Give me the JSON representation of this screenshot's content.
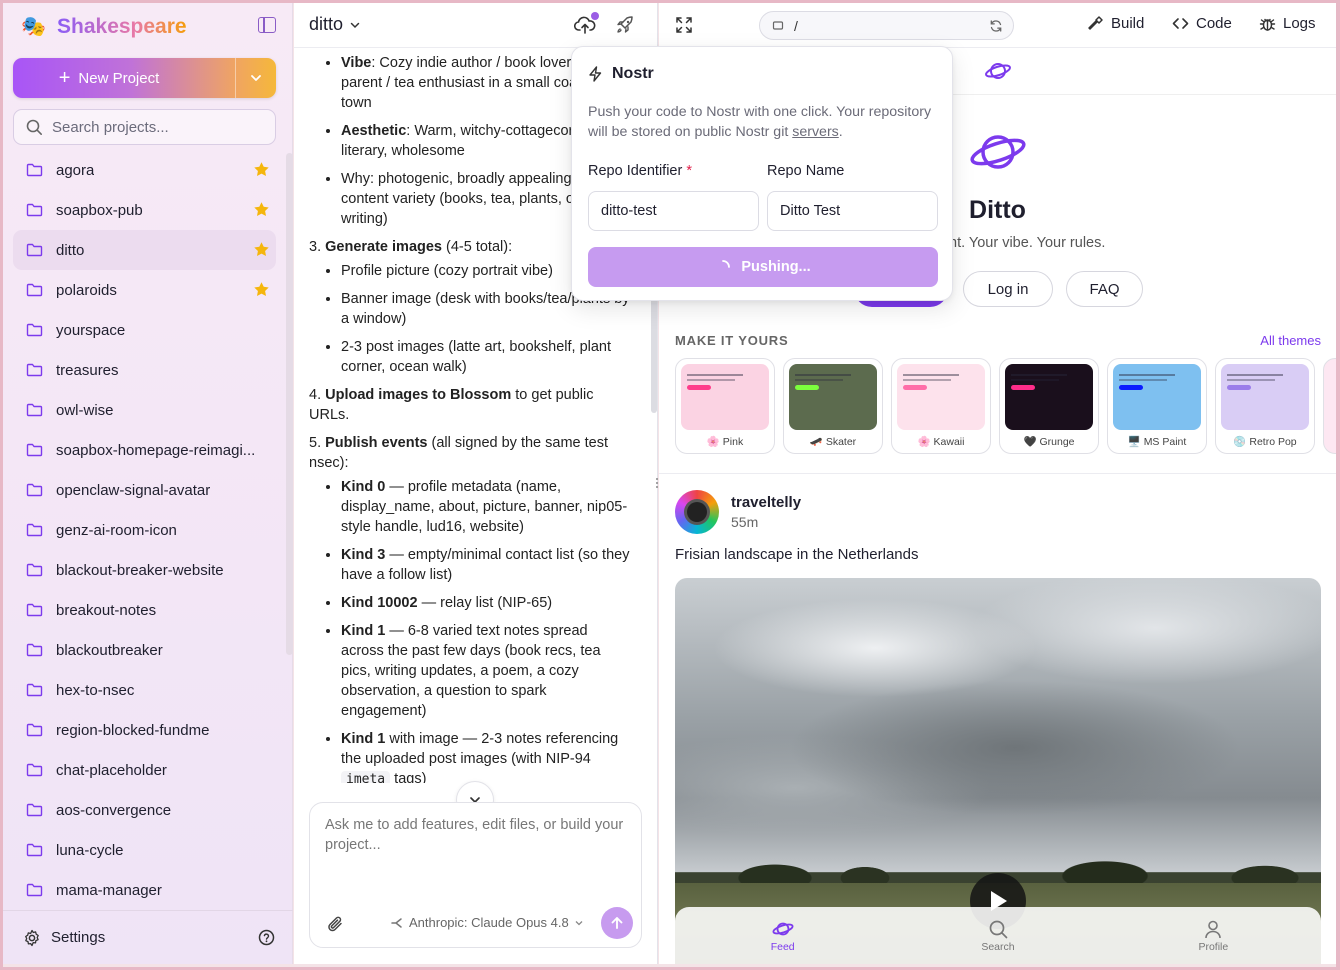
{
  "sidebar": {
    "brand": "Shakespeare",
    "new_project": "New Project",
    "search_placeholder": "Search projects...",
    "projects": [
      {
        "name": "agora",
        "starred": true
      },
      {
        "name": "soapbox-pub",
        "starred": true
      },
      {
        "name": "ditto",
        "starred": true,
        "active": true
      },
      {
        "name": "polaroids",
        "starred": true
      },
      {
        "name": "yourspace",
        "starred": false
      },
      {
        "name": "treasures",
        "starred": false
      },
      {
        "name": "owl-wise",
        "starred": false
      },
      {
        "name": "soapbox-homepage-reimagi...",
        "starred": false
      },
      {
        "name": "openclaw-signal-avatar",
        "starred": false
      },
      {
        "name": "genz-ai-room-icon",
        "starred": false
      },
      {
        "name": "blackout-breaker-website",
        "starred": false
      },
      {
        "name": "breakout-notes",
        "starred": false
      },
      {
        "name": "blackoutbreaker",
        "starred": false
      },
      {
        "name": "hex-to-nsec",
        "starred": false
      },
      {
        "name": "region-blocked-fundme",
        "starred": false
      },
      {
        "name": "chat-placeholder",
        "starred": false
      },
      {
        "name": "aos-convergence",
        "starred": false
      },
      {
        "name": "luna-cycle",
        "starred": false
      },
      {
        "name": "mama-manager",
        "starred": false
      }
    ],
    "settings": "Settings"
  },
  "chat": {
    "project_title": "ditto",
    "persona": [
      {
        "bold": "Vibe",
        "text": ": Cozy indie author / book lover / plant parent / tea enthusiast in a small coastal town"
      },
      {
        "bold": "Aesthetic",
        "text": ": Warm, witchy-cottagecore, literary, wholesome"
      },
      {
        "bold": "",
        "text": "Why: photogenic, broadly appealing, natural content variety (books, tea, plants, ocean, writing)"
      }
    ],
    "step3": {
      "num": "3.",
      "bold": "Generate images",
      "text": " (4-5 total):"
    },
    "step3_items": [
      "Profile picture (cozy portrait vibe)",
      "Banner image (desk with books/tea/plants by a window)",
      "2-3 post images (latte art, bookshelf, plant corner, ocean walk)"
    ],
    "step4": {
      "num": "4.",
      "bold": "Upload images to Blossom",
      "text": " to get public URLs."
    },
    "step5": {
      "num": "5.",
      "bold": "Publish events",
      "text": " (all signed by the same test nsec):"
    },
    "step5_items": [
      {
        "bold": "Kind 0",
        "text": " — profile metadata (name, display_name, about, picture, banner, nip05-style handle, lud16, website)"
      },
      {
        "bold": "Kind 3",
        "text": " — empty/minimal contact list (so they have a follow list)"
      },
      {
        "bold": "Kind 10002",
        "text": " — relay list (NIP-65)"
      },
      {
        "bold": "Kind 1",
        "text": " — 6-8 varied text notes spread across the past few days (book recs, tea pics, writing updates, a poem, a cozy observation, a question to spark engagement)"
      }
    ],
    "last_item": {
      "bold": "Kind 1",
      "text": " with image — 2-3 notes referencing the uploaded post images (with NIP-94 ",
      "code": "imeta",
      "after": " tags)"
    },
    "composer_placeholder": "Ask me to add features, edit files, or build your project...",
    "model": "Anthropic: Claude Opus 4.8"
  },
  "preview": {
    "url": "/",
    "tabs": {
      "build": "Build",
      "code": "Code",
      "logs": "Logs"
    },
    "app_title": "Ditto",
    "tagline": "nt. Your vibe. Your rules.",
    "login": "Log in",
    "faq": "FAQ",
    "make_it_yours": "MAKE IT YOURS",
    "all_themes": "All themes",
    "themes": [
      {
        "name": "Pink",
        "emoji": "🌸",
        "bg": "#fbd3e3",
        "pill": "#ff3d8b"
      },
      {
        "name": "Skater",
        "emoji": "🛹",
        "bg": "#5c6b4e",
        "pill": "#7cff3d"
      },
      {
        "name": "Kawaii",
        "emoji": "🌸",
        "bg": "#fde2ec",
        "pill": "#ff6ea8"
      },
      {
        "name": "Grunge",
        "emoji": "🖤",
        "bg": "#1a0f1c",
        "pill": "#ff2d8a"
      },
      {
        "name": "MS Paint",
        "emoji": "🖥️",
        "bg": "#7ec0f0",
        "pill": "#0b1bff"
      },
      {
        "name": "Retro Pop",
        "emoji": "💿",
        "bg": "#d9cdf5",
        "pill": "#9b7dea"
      }
    ],
    "post": {
      "author": "traveltelly",
      "time": "55m",
      "text": "Frisian landscape in the Netherlands"
    },
    "nav": {
      "feed": "Feed",
      "search": "Search",
      "profile": "Profile"
    },
    "accent": "#7c3aed"
  },
  "popover": {
    "title": "Nostr",
    "desc_before": "Push your code to Nostr with one click. Your repository will be stored on public Nostr git ",
    "desc_link": "servers",
    "desc_after": ".",
    "repo_id_label": "Repo Identifier",
    "required_mark": "*",
    "repo_id_value": "ditto-test",
    "repo_name_label": "Repo Name",
    "repo_name_value": "Ditto Test",
    "push_label": "Pushing..."
  }
}
